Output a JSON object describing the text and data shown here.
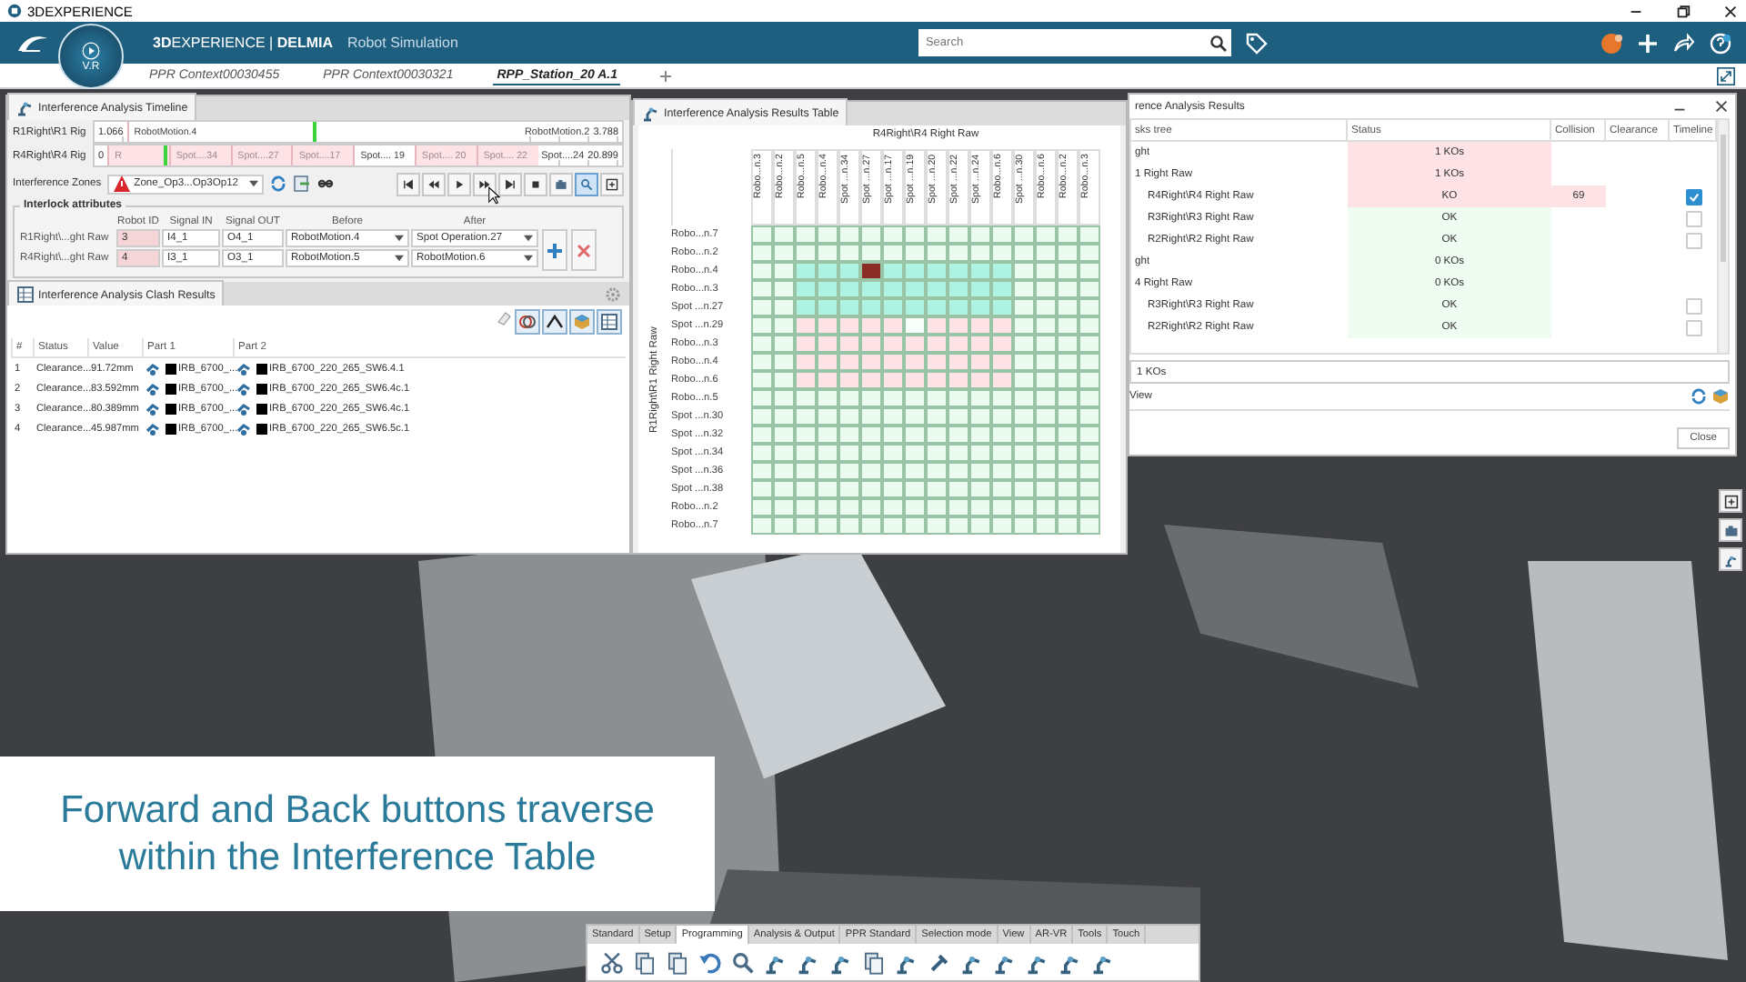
{
  "titlebar": {
    "title": "3DEXPERIENCE"
  },
  "header": {
    "brand": "**3D**EXPERIENCE | **DELMIA**",
    "app": "Robot Simulation",
    "compass_label": "V.R",
    "search": {
      "placeholder": "Search"
    }
  },
  "tabs": [
    {
      "label": "PPR Context00030455",
      "selected": false
    },
    {
      "label": "PPR Context00030321",
      "selected": false
    },
    {
      "label": "RPP_Station_20 A.1",
      "selected": true
    }
  ],
  "timeline_panel": {
    "title": "Interference Analysis Timeline",
    "tracks": [
      {
        "label": "R1Right\\R1 Rig",
        "start": "1.066",
        "end_label": "RobotMotion.2",
        "end_value": "3.788",
        "level": 0.47,
        "segments": [
          {
            "label": "RobotMotion.4",
            "interference": false
          }
        ]
      },
      {
        "label": "R4Right\\R4 Rig",
        "start": "0",
        "end_label": "Spot....24",
        "end_value": "20.899",
        "level": 0.13,
        "segments": [
          {
            "label": "R",
            "interference": true
          },
          {
            "label": "Spot....34",
            "interference": true
          },
          {
            "label": "Spot....27",
            "interference": true
          },
          {
            "label": "Spot....17",
            "interference": true
          },
          {
            "label": "Spot.... 19",
            "interference": false
          },
          {
            "label": "Spot.... 20",
            "interference": true
          },
          {
            "label": "Spot.... 22",
            "interference": true
          }
        ]
      }
    ],
    "zones_label": "Interference Zones",
    "zone": "Zone_Op3...Op3Op12",
    "zoom_tool_on": true,
    "interlock": {
      "title": "Interlock attributes",
      "columns": [
        "Robot ID",
        "Signal IN",
        "Signal OUT",
        "Before",
        "After"
      ],
      "rows": [
        {
          "name": "R1Right\\...ght Raw",
          "robot_id": "3",
          "signal_in": "I4_1",
          "signal_out": "O4_1",
          "before": "RobotMotion.4",
          "after": "Spot Operation.27"
        },
        {
          "name": "R4Right\\...ght Raw",
          "robot_id": "4",
          "signal_in": "I3_1",
          "signal_out": "O3_1",
          "before": "RobotMotion.5",
          "after": "RobotMotion.6"
        }
      ]
    }
  },
  "clash_results": {
    "title": "Interference Analysis Clash Results",
    "columns": [
      "#",
      "Status",
      "Value",
      "Part 1",
      "Part 2"
    ],
    "rows": [
      {
        "index": "1",
        "status": "Clearance...",
        "value": "91.72mm",
        "part1": "IRB_6700_...",
        "part2": "IRB_6700_220_265_SW6.4.1"
      },
      {
        "index": "2",
        "status": "Clearance...",
        "value": "83.592mm",
        "part1": "IRB_6700_...",
        "part2": "IRB_6700_220_265_SW6.4c.1"
      },
      {
        "index": "3",
        "status": "Clearance...",
        "value": "80.389mm",
        "part1": "IRB_6700_...",
        "part2": "IRB_6700_220_265_SW6.4c.1"
      },
      {
        "index": "4",
        "status": "Clearance...",
        "value": "45.987mm",
        "part1": "IRB_6700_...",
        "part2": "IRB_6700_220_265_SW6.5c.1"
      }
    ]
  },
  "results_table": {
    "title": "Interference Analysis Results Table",
    "column_group": "R4Right\\R4 Right Raw",
    "row_group": "R1Right\\R1 Right Raw",
    "columns": [
      "Robo...n.3",
      "Robo...n.2",
      "Robo...n.5",
      "Robo...n.4",
      "Spot ...n.34",
      "Spot ...n.27",
      "Spot ...n.17",
      "Spot ...n.19",
      "Spot ...n.20",
      "Spot ...n.22",
      "Spot ...n.24",
      "Robo...n.6",
      "Spot ...n.30",
      "Robo...n.6",
      "Robo...n.2",
      "Robo...n.3"
    ],
    "rows": [
      {
        "label": "Robo...n.7",
        "cells": [
          {
            "kind": "ok"
          },
          {
            "kind": "ok"
          },
          {
            "kind": "ok"
          },
          {
            "kind": "ok"
          },
          {
            "kind": "ok"
          },
          {
            "kind": "ok"
          },
          {
            "kind": "ok"
          },
          {
            "kind": "ok"
          },
          {
            "kind": "ok"
          },
          {
            "kind": "ok"
          },
          {
            "kind": "ok"
          },
          {
            "kind": "ok"
          },
          {
            "kind": "ok"
          },
          {
            "kind": "ok"
          },
          {
            "kind": "ok"
          },
          {
            "kind": "ok"
          }
        ]
      },
      {
        "label": "Robo...n.2",
        "cells": [
          {
            "kind": "ok"
          },
          {
            "kind": "ok"
          },
          {
            "kind": "ok"
          },
          {
            "kind": "ok"
          },
          {
            "kind": "ok"
          },
          {
            "kind": "ok"
          },
          {
            "kind": "ok"
          },
          {
            "kind": "ok"
          },
          {
            "kind": "ok"
          },
          {
            "kind": "ok"
          },
          {
            "kind": "ok"
          },
          {
            "kind": "ok"
          },
          {
            "kind": "ok"
          },
          {
            "kind": "ok"
          },
          {
            "kind": "ok"
          },
          {
            "kind": "ok"
          }
        ]
      },
      {
        "label": "Robo...n.4",
        "cells": [
          {
            "kind": "ok"
          },
          {
            "kind": "ok"
          },
          {
            "kind": "overlap"
          },
          {
            "kind": "overlap"
          },
          {
            "kind": "overlap"
          },
          {
            "kind": "collision"
          },
          {
            "kind": "overlap"
          },
          {
            "kind": "overlap"
          },
          {
            "kind": "overlap"
          },
          {
            "kind": "overlap"
          },
          {
            "kind": "overlap"
          },
          {
            "kind": "overlap"
          },
          {
            "kind": "ok"
          },
          {
            "kind": "ok"
          },
          {
            "kind": "ok"
          },
          {
            "kind": "ok"
          }
        ]
      },
      {
        "label": "Robo...n.3",
        "cells": [
          {
            "kind": "ok"
          },
          {
            "kind": "ok"
          },
          {
            "kind": "overlap"
          },
          {
            "kind": "overlap"
          },
          {
            "kind": "overlap"
          },
          {
            "kind": "overlap"
          },
          {
            "kind": "overlap"
          },
          {
            "kind": "overlap"
          },
          {
            "kind": "overlap"
          },
          {
            "kind": "overlap"
          },
          {
            "kind": "overlap"
          },
          {
            "kind": "overlap"
          },
          {
            "kind": "ok"
          },
          {
            "kind": "ok"
          },
          {
            "kind": "ok"
          },
          {
            "kind": "ok"
          }
        ]
      },
      {
        "label": "Spot ...n.27",
        "cells": [
          {
            "kind": "ok"
          },
          {
            "kind": "ok"
          },
          {
            "kind": "overlap"
          },
          {
            "kind": "overlap"
          },
          {
            "kind": "overlap"
          },
          {
            "kind": "overlap"
          },
          {
            "kind": "overlap"
          },
          {
            "kind": "overlap"
          },
          {
            "kind": "overlap"
          },
          {
            "kind": "overlap"
          },
          {
            "kind": "overlap"
          },
          {
            "kind": "overlap"
          },
          {
            "kind": "ok"
          },
          {
            "kind": "ok"
          },
          {
            "kind": "ok"
          },
          {
            "kind": "ok"
          }
        ]
      },
      {
        "label": "Spot ...n.29",
        "cells": [
          {
            "kind": "ok"
          },
          {
            "kind": "ok"
          },
          {
            "kind": "interference"
          },
          {
            "kind": "interference"
          },
          {
            "kind": "interference"
          },
          {
            "kind": "interference"
          },
          {
            "kind": "interference"
          },
          {
            "kind": "clear"
          },
          {
            "kind": "interference"
          },
          {
            "kind": "interference"
          },
          {
            "kind": "interference"
          },
          {
            "kind": "interference"
          },
          {
            "kind": "ok"
          },
          {
            "kind": "ok"
          },
          {
            "kind": "ok"
          },
          {
            "kind": "ok"
          }
        ]
      },
      {
        "label": "Robo...n.3",
        "cells": [
          {
            "kind": "ok"
          },
          {
            "kind": "ok"
          },
          {
            "kind": "interference"
          },
          {
            "kind": "interference"
          },
          {
            "kind": "interference"
          },
          {
            "kind": "interference"
          },
          {
            "kind": "interference"
          },
          {
            "kind": "interference"
          },
          {
            "kind": "interference"
          },
          {
            "kind": "interference"
          },
          {
            "kind": "interference"
          },
          {
            "kind": "interference"
          },
          {
            "kind": "ok"
          },
          {
            "kind": "ok"
          },
          {
            "kind": "ok"
          },
          {
            "kind": "ok"
          }
        ]
      },
      {
        "label": "Robo...n.4",
        "cells": [
          {
            "kind": "ok"
          },
          {
            "kind": "ok"
          },
          {
            "kind": "interference"
          },
          {
            "kind": "interference"
          },
          {
            "kind": "interference"
          },
          {
            "kind": "interference"
          },
          {
            "kind": "interference"
          },
          {
            "kind": "interference"
          },
          {
            "kind": "interference"
          },
          {
            "kind": "interference"
          },
          {
            "kind": "interference"
          },
          {
            "kind": "interference"
          },
          {
            "kind": "ok"
          },
          {
            "kind": "ok"
          },
          {
            "kind": "ok"
          },
          {
            "kind": "ok"
          }
        ]
      },
      {
        "label": "Robo...n.6",
        "cells": [
          {
            "kind": "ok"
          },
          {
            "kind": "ok"
          },
          {
            "kind": "interference"
          },
          {
            "kind": "interference"
          },
          {
            "kind": "interference"
          },
          {
            "kind": "interference"
          },
          {
            "kind": "interference"
          },
          {
            "kind": "interference"
          },
          {
            "kind": "interference"
          },
          {
            "kind": "interference"
          },
          {
            "kind": "interference"
          },
          {
            "kind": "interference"
          },
          {
            "kind": "ok"
          },
          {
            "kind": "ok"
          },
          {
            "kind": "ok"
          },
          {
            "kind": "ok"
          }
        ]
      },
      {
        "label": "Robo...n.5",
        "cells": [
          {
            "kind": "ok"
          },
          {
            "kind": "ok"
          },
          {
            "kind": "ok"
          },
          {
            "kind": "ok"
          },
          {
            "kind": "ok"
          },
          {
            "kind": "ok"
          },
          {
            "kind": "ok"
          },
          {
            "kind": "ok"
          },
          {
            "kind": "ok"
          },
          {
            "kind": "ok"
          },
          {
            "kind": "ok"
          },
          {
            "kind": "ok"
          },
          {
            "kind": "ok"
          },
          {
            "kind": "ok"
          },
          {
            "kind": "ok"
          },
          {
            "kind": "ok"
          }
        ]
      },
      {
        "label": "Spot ...n.30",
        "cells": [
          {
            "kind": "ok"
          },
          {
            "kind": "ok"
          },
          {
            "kind": "ok"
          },
          {
            "kind": "ok"
          },
          {
            "kind": "ok"
          },
          {
            "kind": "ok"
          },
          {
            "kind": "ok"
          },
          {
            "kind": "ok"
          },
          {
            "kind": "ok"
          },
          {
            "kind": "ok"
          },
          {
            "kind": "ok"
          },
          {
            "kind": "ok"
          },
          {
            "kind": "ok"
          },
          {
            "kind": "ok"
          },
          {
            "kind": "ok"
          },
          {
            "kind": "ok"
          }
        ]
      },
      {
        "label": "Spot ...n.32",
        "cells": [
          {
            "kind": "ok"
          },
          {
            "kind": "ok"
          },
          {
            "kind": "ok"
          },
          {
            "kind": "ok"
          },
          {
            "kind": "ok"
          },
          {
            "kind": "ok"
          },
          {
            "kind": "ok"
          },
          {
            "kind": "ok"
          },
          {
            "kind": "ok"
          },
          {
            "kind": "ok"
          },
          {
            "kind": "ok"
          },
          {
            "kind": "ok"
          },
          {
            "kind": "ok"
          },
          {
            "kind": "ok"
          },
          {
            "kind": "ok"
          },
          {
            "kind": "ok"
          }
        ]
      },
      {
        "label": "Spot ...n.34",
        "cells": [
          {
            "kind": "ok"
          },
          {
            "kind": "ok"
          },
          {
            "kind": "ok"
          },
          {
            "kind": "ok"
          },
          {
            "kind": "ok"
          },
          {
            "kind": "ok"
          },
          {
            "kind": "ok"
          },
          {
            "kind": "ok"
          },
          {
            "kind": "ok"
          },
          {
            "kind": "ok"
          },
          {
            "kind": "ok"
          },
          {
            "kind": "ok"
          },
          {
            "kind": "ok"
          },
          {
            "kind": "ok"
          },
          {
            "kind": "ok"
          },
          {
            "kind": "ok"
          }
        ]
      },
      {
        "label": "Spot ...n.36",
        "cells": [
          {
            "kind": "ok"
          },
          {
            "kind": "ok"
          },
          {
            "kind": "ok"
          },
          {
            "kind": "ok"
          },
          {
            "kind": "ok"
          },
          {
            "kind": "ok"
          },
          {
            "kind": "ok"
          },
          {
            "kind": "ok"
          },
          {
            "kind": "ok"
          },
          {
            "kind": "ok"
          },
          {
            "kind": "ok"
          },
          {
            "kind": "ok"
          },
          {
            "kind": "ok"
          },
          {
            "kind": "ok"
          },
          {
            "kind": "ok"
          },
          {
            "kind": "ok"
          }
        ]
      },
      {
        "label": "Spot ...n.38",
        "cells": [
          {
            "kind": "ok"
          },
          {
            "kind": "ok"
          },
          {
            "kind": "ok"
          },
          {
            "kind": "ok"
          },
          {
            "kind": "ok"
          },
          {
            "kind": "ok"
          },
          {
            "kind": "ok"
          },
          {
            "kind": "ok"
          },
          {
            "kind": "ok"
          },
          {
            "kind": "ok"
          },
          {
            "kind": "ok"
          },
          {
            "kind": "ok"
          },
          {
            "kind": "ok"
          },
          {
            "kind": "ok"
          },
          {
            "kind": "ok"
          },
          {
            "kind": "ok"
          }
        ]
      },
      {
        "label": "Robo...n.2",
        "cells": [
          {
            "kind": "ok"
          },
          {
            "kind": "ok"
          },
          {
            "kind": "ok"
          },
          {
            "kind": "ok"
          },
          {
            "kind": "ok"
          },
          {
            "kind": "ok"
          },
          {
            "kind": "ok"
          },
          {
            "kind": "ok"
          },
          {
            "kind": "ok"
          },
          {
            "kind": "ok"
          },
          {
            "kind": "ok"
          },
          {
            "kind": "ok"
          },
          {
            "kind": "ok"
          },
          {
            "kind": "ok"
          },
          {
            "kind": "ok"
          },
          {
            "kind": "ok"
          }
        ]
      },
      {
        "label": "Robo...n.7",
        "cells": [
          {
            "kind": "ok"
          },
          {
            "kind": "ok"
          },
          {
            "kind": "ok"
          },
          {
            "kind": "ok"
          },
          {
            "kind": "ok"
          },
          {
            "kind": "ok"
          },
          {
            "kind": "ok"
          },
          {
            "kind": "ok"
          },
          {
            "kind": "ok"
          },
          {
            "kind": "ok"
          },
          {
            "kind": "ok"
          },
          {
            "kind": "ok"
          },
          {
            "kind": "ok"
          },
          {
            "kind": "ok"
          },
          {
            "kind": "ok"
          },
          {
            "kind": "ok"
          }
        ]
      }
    ]
  },
  "analysis_window": {
    "title": "rence Analysis Results",
    "columns": [
      "sks tree",
      "Status",
      "Collision",
      "Clearance",
      "Timeline"
    ],
    "tree": [
      {
        "name": "ght",
        "status": "1 KOs",
        "failed": true,
        "children": [
          {
            "name": "1 Right Raw",
            "status": "1 KOs",
            "failed": true,
            "children": [
              {
                "name": "R4Right\\R4 Right Raw",
                "status": "KO",
                "failed": true,
                "collision": "69",
                "checked": true
              },
              {
                "name": "R3Right\\R3 Right Raw",
                "status": "OK",
                "failed": false,
                "checked": false
              },
              {
                "name": "R2Right\\R2 Right Raw",
                "status": "OK",
                "failed": false,
                "checked": false
              }
            ]
          }
        ]
      },
      {
        "name": "ght",
        "status": "0 KOs",
        "failed": false,
        "children": [
          {
            "name": "4 Right Raw",
            "status": "0 KOs",
            "failed": false,
            "children": [
              {
                "name": "R3Right\\R3 Right Raw",
                "status": "OK",
                "failed": false,
                "checked": false
              },
              {
                "name": "R2Right\\R2 Right Raw",
                "status": "OK",
                "failed": false,
                "checked": false
              }
            ]
          }
        ]
      }
    ],
    "summary": "1 KOs",
    "view_label": "View",
    "close": "Close"
  },
  "caption": "Forward and Back buttons traverse within the Interference Table",
  "bottom_toolbar": {
    "tabs": [
      {
        "label": "Standard",
        "selected": false
      },
      {
        "label": "Setup",
        "selected": false
      },
      {
        "label": "Programming",
        "selected": true
      },
      {
        "label": "Analysis & Output",
        "selected": false
      },
      {
        "label": "PPR Standard",
        "selected": false
      },
      {
        "label": "Selection mode",
        "selected": false
      },
      {
        "label": "View",
        "selected": false
      },
      {
        "label": "AR-VR",
        "selected": false
      },
      {
        "label": "Tools",
        "selected": false
      },
      {
        "label": "Touch",
        "selected": false
      }
    ]
  }
}
